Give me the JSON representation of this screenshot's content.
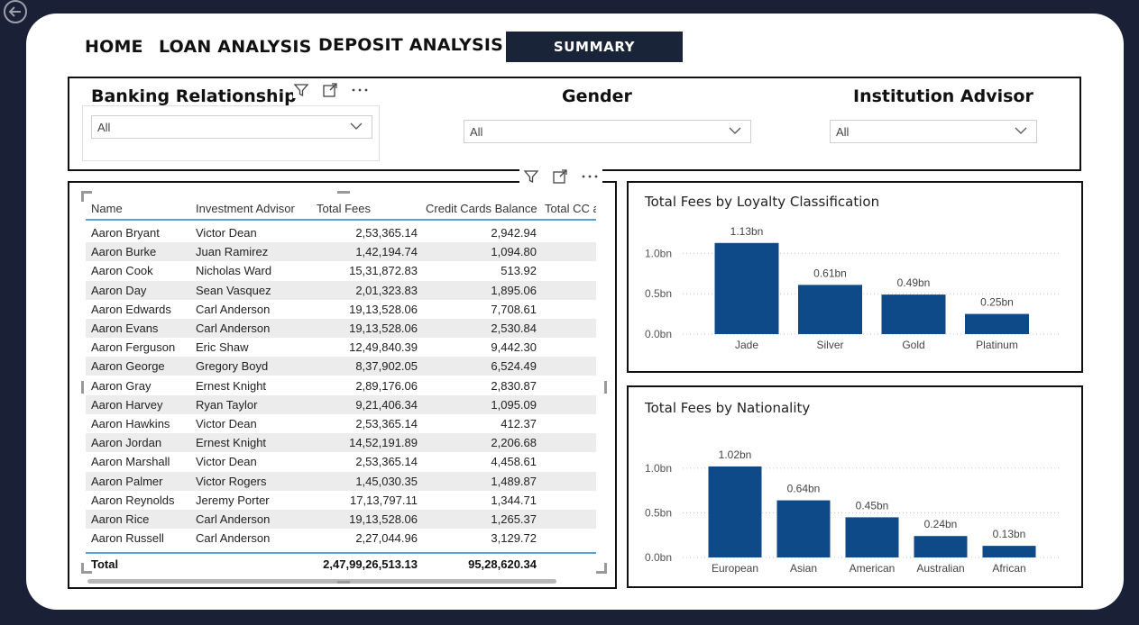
{
  "app": {
    "back_icon": "back-arrow-icon"
  },
  "nav": {
    "home": "HOME",
    "loan": "LOAN ANALYSIS",
    "deposit": "DEPOSIT ANALYSIS",
    "summary": "SUMMARY"
  },
  "filters": {
    "banking_relationship": {
      "title": "Banking Relationship",
      "value": "All"
    },
    "gender": {
      "title": "Gender",
      "value": "All"
    },
    "institution_advisor": {
      "title": "Institution Advisor",
      "value": "All"
    }
  },
  "table": {
    "columns": [
      "Name",
      "Investment Advisor",
      "Total Fees",
      "Credit Cards Balance",
      "Total CC a"
    ],
    "rows": [
      [
        "Aaron Bryant",
        "Victor Dean",
        "2,53,365.14",
        "2,942.94"
      ],
      [
        "Aaron Burke",
        "Juan Ramirez",
        "1,42,194.74",
        "1,094.80"
      ],
      [
        "Aaron Cook",
        "Nicholas Ward",
        "15,31,872.83",
        "513.92"
      ],
      [
        "Aaron Day",
        "Sean Vasquez",
        "2,01,323.83",
        "1,895.06"
      ],
      [
        "Aaron Edwards",
        "Carl Anderson",
        "19,13,528.06",
        "7,708.61"
      ],
      [
        "Aaron Evans",
        "Carl Anderson",
        "19,13,528.06",
        "2,530.84"
      ],
      [
        "Aaron Ferguson",
        "Eric Shaw",
        "12,49,840.39",
        "9,442.30"
      ],
      [
        "Aaron George",
        "Gregory Boyd",
        "8,37,902.05",
        "6,524.49"
      ],
      [
        "Aaron Gray",
        "Ernest Knight",
        "2,89,176.06",
        "2,830.87"
      ],
      [
        "Aaron Harvey",
        "Ryan Taylor",
        "9,21,406.34",
        "1,095.09"
      ],
      [
        "Aaron Hawkins",
        "Victor Dean",
        "2,53,365.14",
        "412.37"
      ],
      [
        "Aaron Jordan",
        "Ernest Knight",
        "14,52,191.89",
        "2,206.68"
      ],
      [
        "Aaron Marshall",
        "Victor Dean",
        "2,53,365.14",
        "4,458.61"
      ],
      [
        "Aaron Palmer",
        "Victor Rogers",
        "1,45,030.35",
        "1,489.87"
      ],
      [
        "Aaron Reynolds",
        "Jeremy Porter",
        "17,13,797.11",
        "1,344.71"
      ],
      [
        "Aaron Rice",
        "Carl Anderson",
        "19,13,528.06",
        "1,265.37"
      ],
      [
        "Aaron Russell",
        "Carl Anderson",
        "2,27,044.96",
        "3,129.72"
      ]
    ],
    "total": {
      "label": "Total",
      "fees": "2,47,99,26,513.13",
      "cc": "95,28,620.34"
    }
  },
  "chart_data": [
    {
      "type": "bar",
      "title": "Total Fees by Loyalty Classification",
      "categories": [
        "Jade",
        "Silver",
        "Gold",
        "Platinum"
      ],
      "values": [
        1.13,
        0.61,
        0.49,
        0.25
      ],
      "data_labels": [
        "1.13bn",
        "0.61bn",
        "0.49bn",
        "0.25bn"
      ],
      "yticks": [
        "0.0bn",
        "0.5bn",
        "1.0bn"
      ],
      "ylim": [
        0,
        1.2
      ],
      "color": "#0d4a87",
      "grid": true
    },
    {
      "type": "bar",
      "title": "Total Fees by Nationality",
      "categories": [
        "European",
        "Asian",
        "American",
        "Australian",
        "African"
      ],
      "values": [
        1.02,
        0.64,
        0.45,
        0.24,
        0.13
      ],
      "data_labels": [
        "1.02bn",
        "0.64bn",
        "0.45bn",
        "0.24bn",
        "0.13bn"
      ],
      "yticks": [
        "0.0bn",
        "0.5bn",
        "1.0bn"
      ],
      "ylim": [
        0,
        1.1
      ],
      "color": "#0d4a87",
      "grid": true
    }
  ]
}
